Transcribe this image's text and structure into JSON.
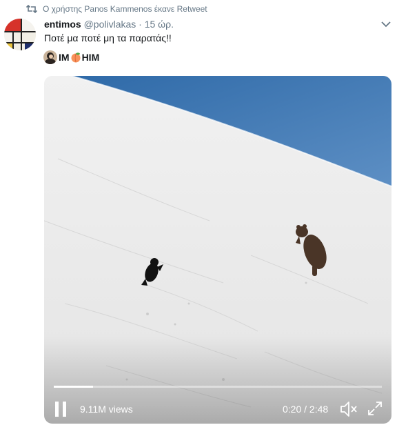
{
  "retweet": {
    "text": "Ο χρήστης Panos Kammenos έκανε Retweet",
    "icon": "retweet-icon"
  },
  "tweet": {
    "name": "entimos",
    "handle": "@polivlakas",
    "separator": "·",
    "time": "15 ώρ.",
    "text": "Ποτέ μα ποτέ μη τα παρατάς!!"
  },
  "profile_line": {
    "left": "IM",
    "right": "HIM"
  },
  "video": {
    "views": "9.11M views",
    "current_time": "0:20",
    "time_separator": "/",
    "duration": "2:48",
    "progress_fraction": 0.119
  },
  "colors": {
    "sky": "#4c7fb7",
    "snow": "#eeeeee",
    "muted_text": "#657786"
  }
}
